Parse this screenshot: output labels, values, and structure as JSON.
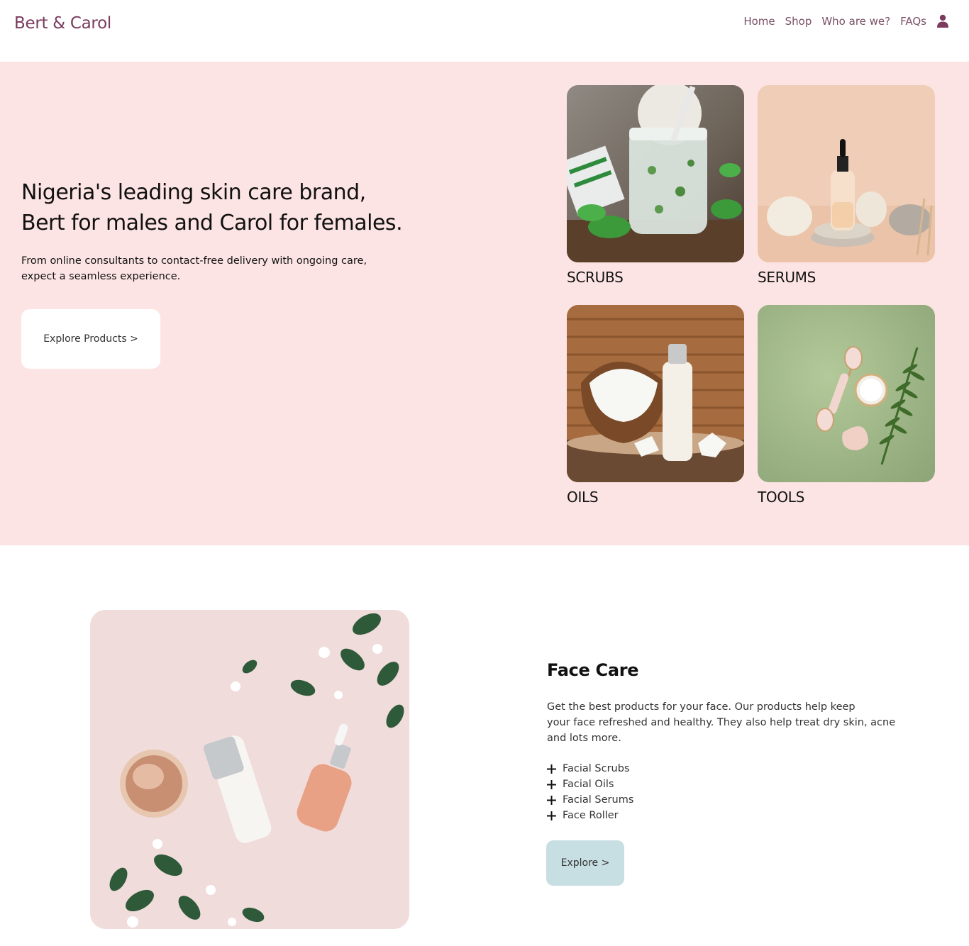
{
  "brand": {
    "name": "Bert & Carol",
    "color": "#7a3b5e"
  },
  "nav": {
    "items": [
      {
        "label": "Home"
      },
      {
        "label": "Shop"
      },
      {
        "label": "Who are we?"
      },
      {
        "label": "FAQs"
      }
    ],
    "account_icon": "user-icon"
  },
  "hero": {
    "title_lines": [
      "Nigeria's leading skin care brand,",
      "Bert for males and Carol for females."
    ],
    "subtitle_lines": [
      "From online consultants to contact-free delivery with ongoing care,",
      "expect a seamless experience."
    ],
    "cta_label": "Explore Products >",
    "background": "#fde4e4"
  },
  "categories": [
    {
      "label": "SCRUBS"
    },
    {
      "label": "SERUMS"
    },
    {
      "label": "OILS"
    },
    {
      "label": "TOOLS"
    }
  ],
  "face_care": {
    "title": "Face Care",
    "description_lines": [
      "Get the best products for your face. Our products help keep",
      "your face refreshed and healthy. They also help treat dry skin, acne",
      "and lots more."
    ],
    "items": [
      "Facial Scrubs",
      "Facial Oils",
      "Facial Serums",
      "Face Roller"
    ],
    "cta_label": "Explore >",
    "cta_color": "#c7dfe3"
  }
}
